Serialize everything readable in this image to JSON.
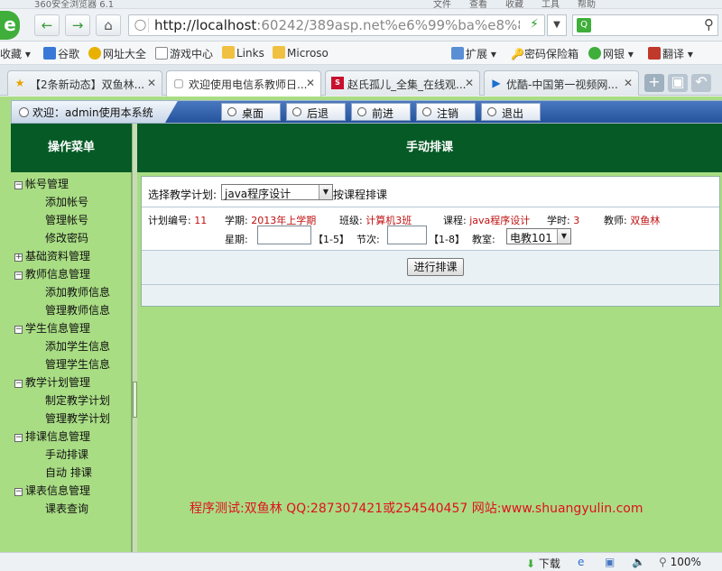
{
  "browser": {
    "title_text": "360安全浏览器 6.1",
    "menu": [
      "文件",
      "查看",
      "收藏",
      "工具",
      "帮助"
    ],
    "url_host": "http://localhost",
    "url_rest": ":60242/389asp.net%e6%99%ba%e8%83%b",
    "search_placeholder": ""
  },
  "bookmarks": {
    "left": [
      "收藏",
      "谷歌",
      "网址大全",
      "游戏中心",
      "Links",
      "Microso"
    ],
    "right": [
      "扩展",
      "密码保险箱",
      "网银",
      "翻译"
    ]
  },
  "tabs": [
    {
      "label": "【2条新动态】双鱼林..."
    },
    {
      "label": "欢迎使用电信系教师日..."
    },
    {
      "label": "赵氏孤儿_全集_在线观..."
    },
    {
      "label": "优酷-中国第一视频网..."
    }
  ],
  "app": {
    "welcome": "欢迎：admin使用本系统",
    "nav": [
      "桌面",
      "后退",
      "前进",
      "注销",
      "退出"
    ],
    "sidebar_title": "操作菜单",
    "main_title": "手动排课",
    "tree": [
      {
        "group": "帐号管理",
        "expanded": true,
        "items": [
          "添加帐号",
          "管理帐号",
          "修改密码"
        ]
      },
      {
        "group": "基础资料管理",
        "expanded": false,
        "items": []
      },
      {
        "group": "教师信息管理",
        "expanded": true,
        "items": [
          "添加教师信息",
          "管理教师信息"
        ]
      },
      {
        "group": "学生信息管理",
        "expanded": true,
        "items": [
          "添加学生信息",
          "管理学生信息"
        ]
      },
      {
        "group": "教学计划管理",
        "expanded": true,
        "items": [
          "制定教学计划",
          "管理教学计划"
        ]
      },
      {
        "group": "排课信息管理",
        "expanded": true,
        "items": [
          "手动排课",
          "自动 排课"
        ]
      },
      {
        "group": "课表信息管理",
        "expanded": true,
        "items": [
          "课表查询"
        ]
      }
    ],
    "form": {
      "plan_label": "选择教学计划:",
      "plan_value": "java程序设计",
      "plan_after": "按课程排课",
      "plan_no_label": "计划编号:",
      "plan_no": "11",
      "term_label": "学期:",
      "term": "2013年上学期",
      "class_label": "班级:",
      "class": "计算机3班",
      "course_label": "课程:",
      "course": "java程序设计",
      "hours_label": "学时:",
      "hours": "3",
      "teacher_label": "教师:",
      "teacher": "双鱼林",
      "week_label": "星期:",
      "week_hint": "【1-5】",
      "period_label": "节次:",
      "period_hint": "【1-8】",
      "room_label": "教室:",
      "room_value": "电教101",
      "submit": "进行排课"
    },
    "footer_note": "程序测试:双鱼林 QQ:287307421或254540457 网站:www.shuangyulin.com"
  },
  "status": {
    "download": "下载",
    "zoom": "100%"
  }
}
